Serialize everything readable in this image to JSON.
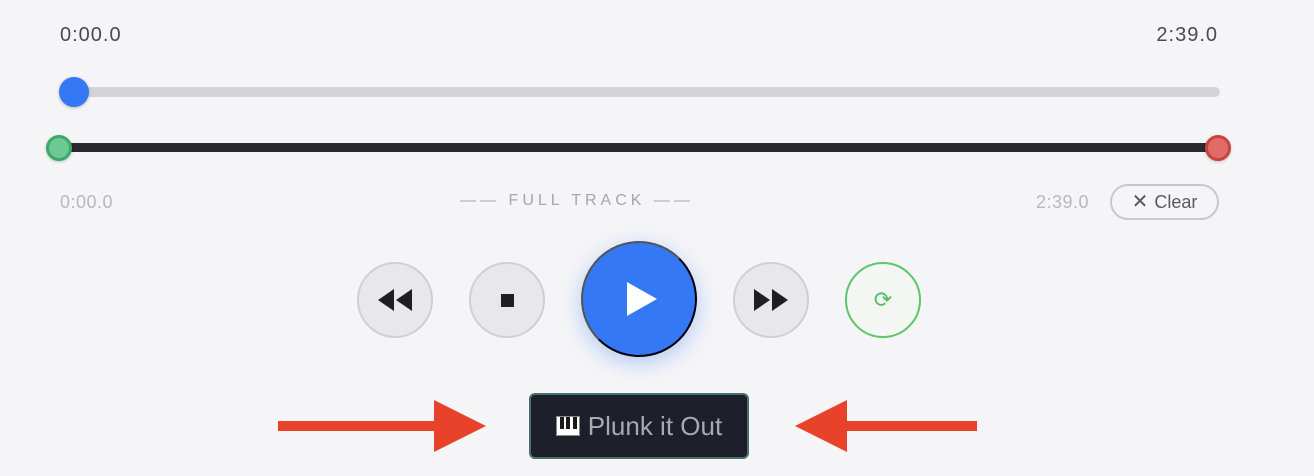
{
  "player": {
    "current_time": "0:00.0",
    "duration": "2:39.0",
    "progress": 0.0
  },
  "range": {
    "start_label": "0:00.0",
    "end_label": "2:39.0",
    "mode_label": "—— FULL TRACK ——",
    "clear_label": "Clear"
  },
  "controls": {
    "rewind": "rewind-icon",
    "stop": "stop-icon",
    "play": "play-icon",
    "fast_forward": "fast-forward-icon",
    "loop": "loop-icon",
    "loop_glyph": "⟳"
  },
  "action": {
    "plunk_label": "Plunk it Out"
  },
  "colors": {
    "accent": "#3478f6",
    "range_start": "#6cc992",
    "range_end": "#e06b68",
    "loop": "#5ac76a",
    "arrow": "#e8432a"
  }
}
